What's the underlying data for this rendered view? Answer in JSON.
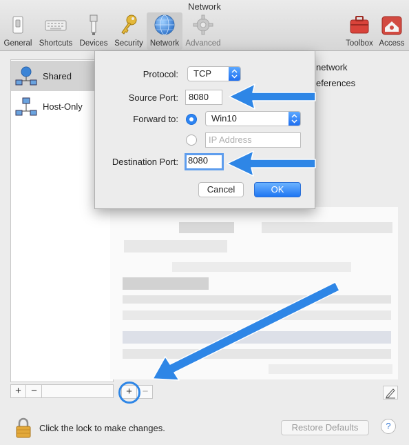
{
  "window": {
    "title": "Network"
  },
  "toolbar": {
    "items": [
      {
        "label": "General",
        "icon": "switch-icon"
      },
      {
        "label": "Shortcuts",
        "icon": "keyboard-icon"
      },
      {
        "label": "Devices",
        "icon": "usb-icon"
      },
      {
        "label": "Security",
        "icon": "key-icon"
      },
      {
        "label": "Network",
        "icon": "globe-icon",
        "selected": true
      },
      {
        "label": "Advanced",
        "icon": "gear-icon",
        "disabled": true
      }
    ],
    "right_items": [
      {
        "label": "Toolbox",
        "icon": "toolbox-icon"
      },
      {
        "label": "Access",
        "icon": "access-icon"
      }
    ]
  },
  "sidebar": {
    "items": [
      {
        "label": "Shared",
        "selected": true
      },
      {
        "label": "Host-Only"
      }
    ]
  },
  "background_text": {
    "line1": "network",
    "line2": "eferences"
  },
  "sheet": {
    "protocol_label": "Protocol:",
    "protocol_value": "TCP",
    "source_port_label": "Source Port:",
    "source_port_value": "8080",
    "forward_to_label": "Forward to:",
    "forward_vm_value": "Win10",
    "ip_address_placeholder": "IP Address",
    "destination_port_label": "Destination Port:",
    "destination_port_value": "8080",
    "cancel_label": "Cancel",
    "ok_label": "OK"
  },
  "pm_bar": {
    "plus": "+",
    "minus": "−"
  },
  "footer": {
    "lock_text": "Click the lock to make changes.",
    "restore_label": "Restore Defaults",
    "help_label": "?"
  },
  "colors": {
    "accent": "#2d84f2",
    "annotation_arrow": "#2e86e6"
  }
}
